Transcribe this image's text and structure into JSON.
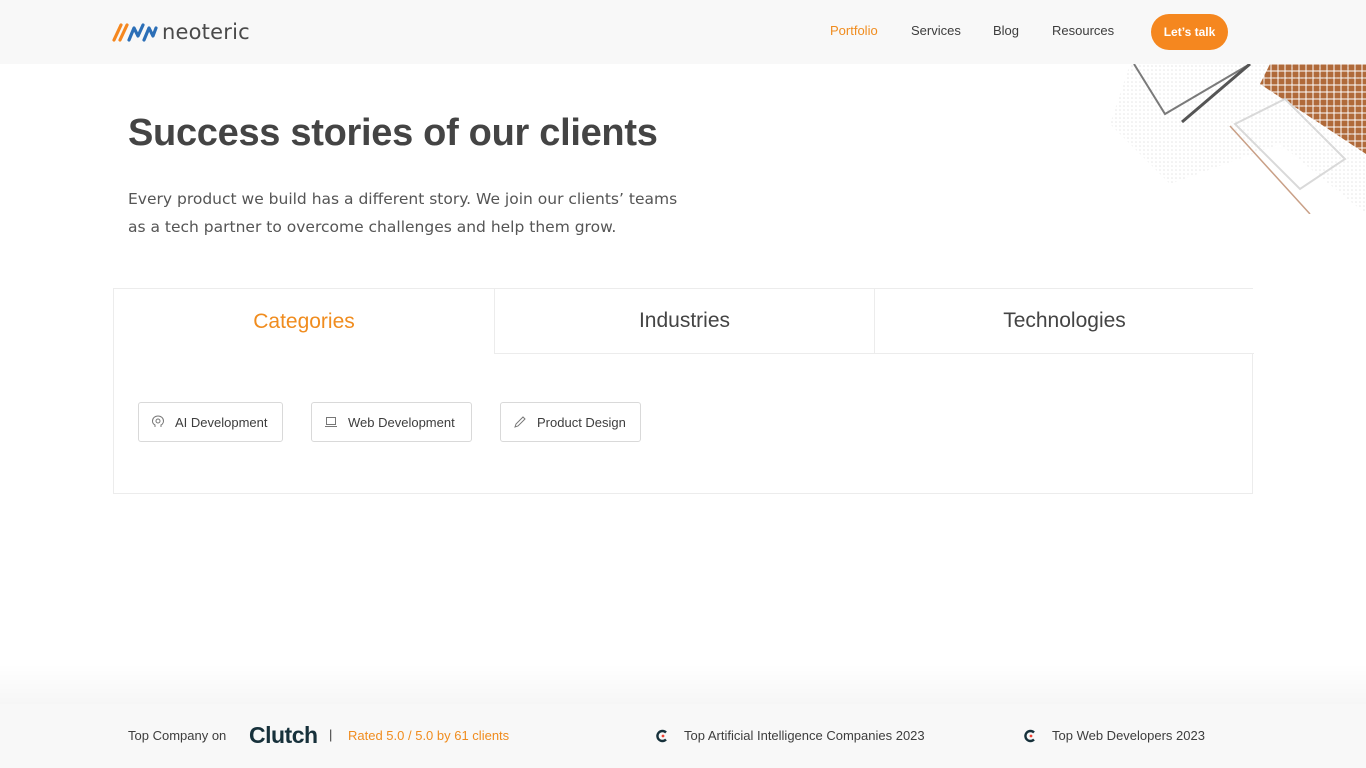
{
  "header": {
    "logo_text": "neoteric",
    "nav": [
      {
        "label": "Portfolio",
        "active": true
      },
      {
        "label": "Services",
        "active": false
      },
      {
        "label": "Blog",
        "active": false
      },
      {
        "label": "Resources",
        "active": false
      }
    ],
    "cta_label": "Let’s talk"
  },
  "hero": {
    "title": "Success stories of our clients",
    "description": "Every product we build has a different story. We join our clients’ teams as a tech partner to overcome challenges and help them grow."
  },
  "tabs": [
    {
      "label": "Categories",
      "active": true
    },
    {
      "label": "Industries",
      "active": false
    },
    {
      "label": "Technologies",
      "active": false
    }
  ],
  "chips": [
    {
      "label": "AI Development",
      "icon": "ai-brain-icon"
    },
    {
      "label": "Web Development",
      "icon": "laptop-icon"
    },
    {
      "label": "Product Design",
      "icon": "pencil-icon"
    }
  ],
  "footer_strip": {
    "top_company_label": "Top Company on",
    "clutch_logo": "Clutch",
    "separator": "|",
    "rating": "Rated 5.0 / 5.0 by 61 clients",
    "awards": [
      "Top Artificial Intelligence Companies 2023",
      "Top Web Developers 2023"
    ]
  },
  "colors": {
    "accent": "#f5871f",
    "text": "#3d3d3d",
    "header_bg": "#f8f8f8"
  }
}
